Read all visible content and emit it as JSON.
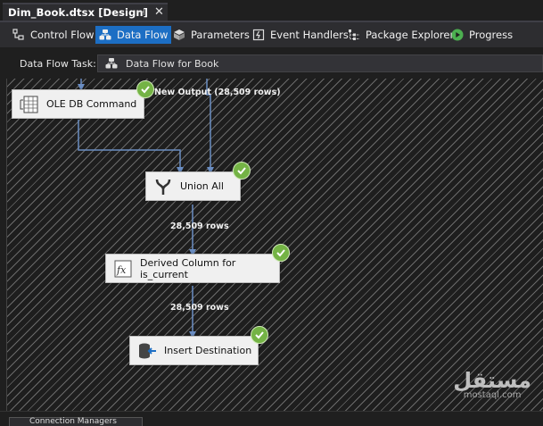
{
  "document_tab": {
    "title": "Dim_Book.dtsx [Design]",
    "pin_glyph": "⊣",
    "close_glyph": "✕"
  },
  "toolbar": {
    "control_flow": "Control Flow",
    "data_flow": "Data Flow",
    "parameters": "Parameters",
    "event_handlers": "Event Handlers",
    "package_explorer": "Package Explorer",
    "progress": "Progress"
  },
  "task": {
    "label": "Data Flow Task:",
    "value": "Data Flow for Book"
  },
  "nodes": {
    "ole_db_command": "OLE DB Command",
    "union_all": "Union All",
    "derived_column": "Derived Column for is_current",
    "insert_destination": "Insert Destination"
  },
  "connectors": {
    "new_output": "New Output (28,509 rows)",
    "union_to_derived": "28,509 rows",
    "derived_to_insert": "28,509 rows"
  },
  "bottom": {
    "connection_managers": "Connection Managers"
  },
  "watermark": {
    "arabic": "مستقل",
    "latin": "mostaql.com"
  },
  "colors": {
    "accent": "#1c6ec4",
    "success": "#74b345",
    "canvas_lines": "#6a6a6a"
  }
}
